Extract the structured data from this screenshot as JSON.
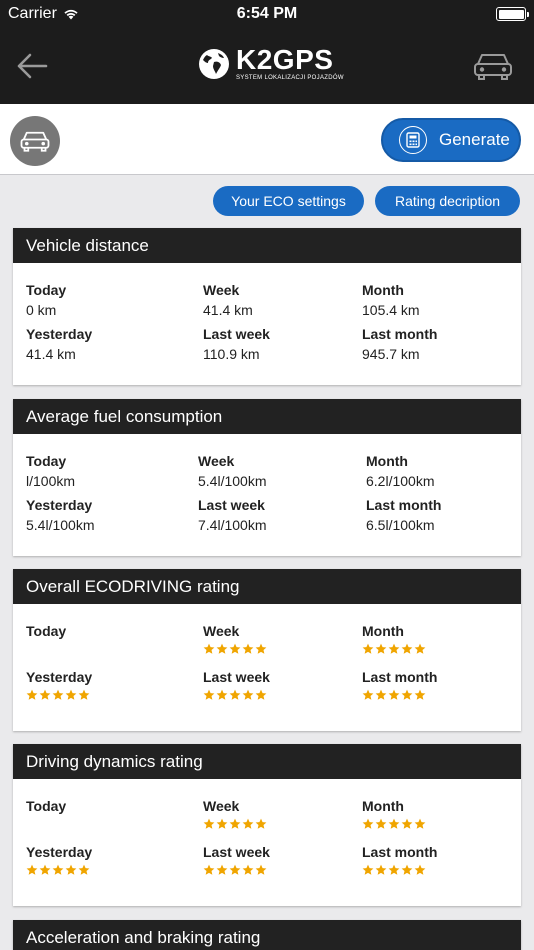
{
  "status_bar": {
    "carrier": "Carrier",
    "time": "6:54 PM"
  },
  "nav": {
    "brand": "K2GPS",
    "brand_subtitle": "SYSTEM LOKALIZACJI POJAZDÓW"
  },
  "toolbar": {
    "generate_label": "Generate"
  },
  "buttons": {
    "eco_settings": "Your ECO settings",
    "rating_description": "Rating decription"
  },
  "colors": {
    "accent": "#1a6bc3",
    "header": "#222222",
    "star": "#f0a500"
  },
  "cards": [
    {
      "title": "Vehicle distance",
      "kind": "values",
      "cells": [
        {
          "label": "Today",
          "value": "0 km"
        },
        {
          "label": "Week",
          "value": "41.4 km"
        },
        {
          "label": "Month",
          "value": "105.4 km"
        },
        {
          "label": "Yesterday",
          "value": "41.4 km"
        },
        {
          "label": "Last week",
          "value": "110.9 km"
        },
        {
          "label": "Last month",
          "value": "945.7 km"
        }
      ]
    },
    {
      "title": "Average fuel consumption",
      "kind": "values",
      "cells": [
        {
          "label": "Today",
          "value": "l/100km"
        },
        {
          "label": "Week",
          "value": "5.4l/100km"
        },
        {
          "label": "Month",
          "value": "6.2l/100km"
        },
        {
          "label": "Yesterday",
          "value": "5.4l/100km"
        },
        {
          "label": "Last week",
          "value": "7.4l/100km"
        },
        {
          "label": "Last month",
          "value": "6.5l/100km"
        }
      ]
    },
    {
      "title": "Overall ECODRIVING rating",
      "kind": "stars",
      "cells": [
        {
          "label": "Today",
          "stars": 0
        },
        {
          "label": "Week",
          "stars": 5
        },
        {
          "label": "Month",
          "stars": 5
        },
        {
          "label": "Yesterday",
          "stars": 5
        },
        {
          "label": "Last week",
          "stars": 5
        },
        {
          "label": "Last month",
          "stars": 5
        }
      ]
    },
    {
      "title": "Driving dynamics rating",
      "kind": "stars",
      "cells": [
        {
          "label": "Today",
          "stars": 0
        },
        {
          "label": "Week",
          "stars": 5
        },
        {
          "label": "Month",
          "stars": 5
        },
        {
          "label": "Yesterday",
          "stars": 5
        },
        {
          "label": "Last week",
          "stars": 5
        },
        {
          "label": "Last month",
          "stars": 5
        }
      ]
    },
    {
      "title": "Acceleration and braking rating",
      "kind": "stars",
      "cells": []
    }
  ]
}
